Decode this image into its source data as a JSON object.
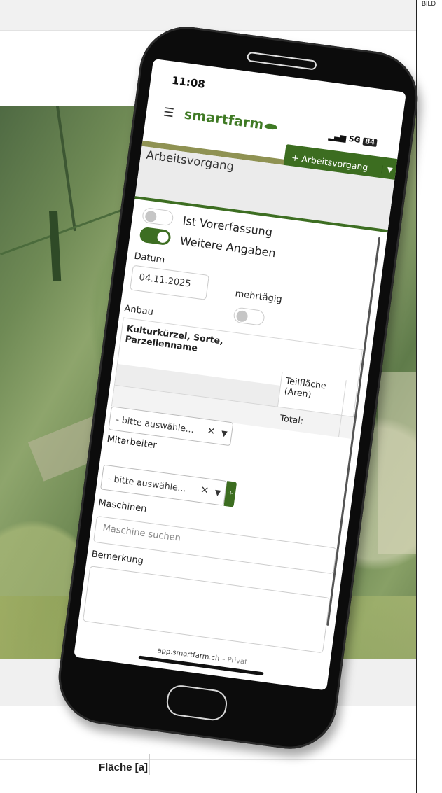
{
  "background": {
    "right_label": "BILD",
    "table_header": "Fläche [a]",
    "map_colors": [
      "#4f6a43",
      "#8ea56c",
      "#99ac77"
    ]
  },
  "phone": {
    "status": {
      "time": "11:08",
      "signal": "5G",
      "battery": "84"
    },
    "header": {
      "app_name": "smartfarm",
      "add_button_label": "+ Arbeitsvorgang",
      "accent_color": "#3c6d20"
    },
    "page_title": "Arbeitsvorgang",
    "form": {
      "toggle_vorerfassung": {
        "label": "Ist Vorerfassung",
        "on": false
      },
      "toggle_weitere": {
        "label": "Weitere Angaben",
        "on": true
      },
      "datum_label": "Datum",
      "datum_value": "04.11.2025",
      "mehrtaegig_label": "mehrtägig",
      "anbau_label": "Anbau",
      "anbau_table": {
        "col1": "Kulturkürzel, Sorte, Parzellenname",
        "col2": "Teilfläche (Aren)",
        "total": "Total:"
      },
      "anbau_select": "- bitte auswähle...",
      "mitarbeiter_label": "Mitarbeiter",
      "mitarbeiter_select": "- bitte auswähle...",
      "add_mitarbeiter": "+",
      "maschinen_label": "Maschinen",
      "maschinen_placeholder": "Maschine suchen",
      "bemerkung_label": "Bemerkung"
    },
    "footer": {
      "url": "app.smartfarm.ch",
      "sep": " – ",
      "privacy": "Privat"
    }
  }
}
